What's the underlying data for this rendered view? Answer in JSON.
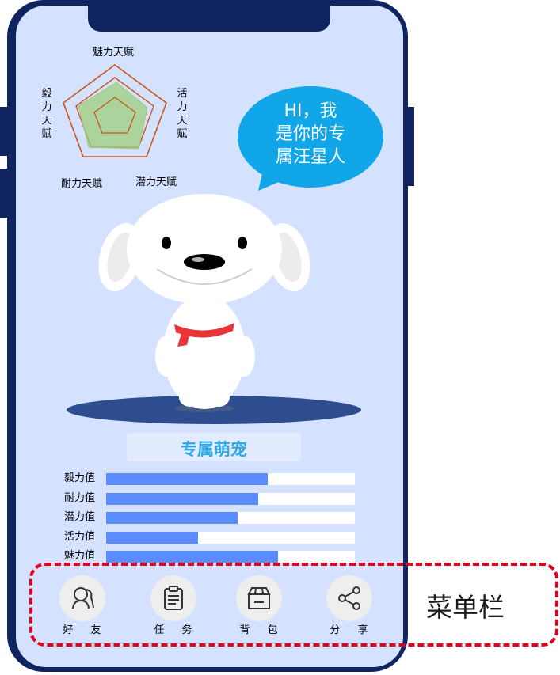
{
  "radar": {
    "axis_labels": {
      "top": "魅力天赋",
      "right": "活力天赋",
      "bottom_right": "潜力天赋",
      "bottom_left": "耐力天赋",
      "left": "毅力天赋"
    }
  },
  "speech_bubble": {
    "line1": "HI，我",
    "line2": "是你的专",
    "line3": "属汪星人"
  },
  "pet_section": {
    "title": "专属萌宠"
  },
  "chart_data": {
    "type": "bar",
    "orientation": "horizontal",
    "categories": [
      "毅力值",
      "耐力值",
      "潜力值",
      "活力值",
      "魅力值"
    ],
    "values": [
      0.65,
      0.61,
      0.53,
      0.37,
      0.69
    ],
    "xlim": [
      0,
      1
    ]
  },
  "menu": {
    "items": [
      {
        "label": "好 友",
        "icon": "friends-icon"
      },
      {
        "label": "任 务",
        "icon": "clipboard-icon"
      },
      {
        "label": "背 包",
        "icon": "box-icon"
      },
      {
        "label": "分 享",
        "icon": "share-icon"
      }
    ],
    "annotation_label": "菜单栏"
  },
  "colors": {
    "phone_frame": "#0f2461",
    "screen_bg": "#d5e2ff",
    "bubble": "#10a6e8",
    "bar_fill": "#5b8cff",
    "annotation": "#e4001b"
  }
}
